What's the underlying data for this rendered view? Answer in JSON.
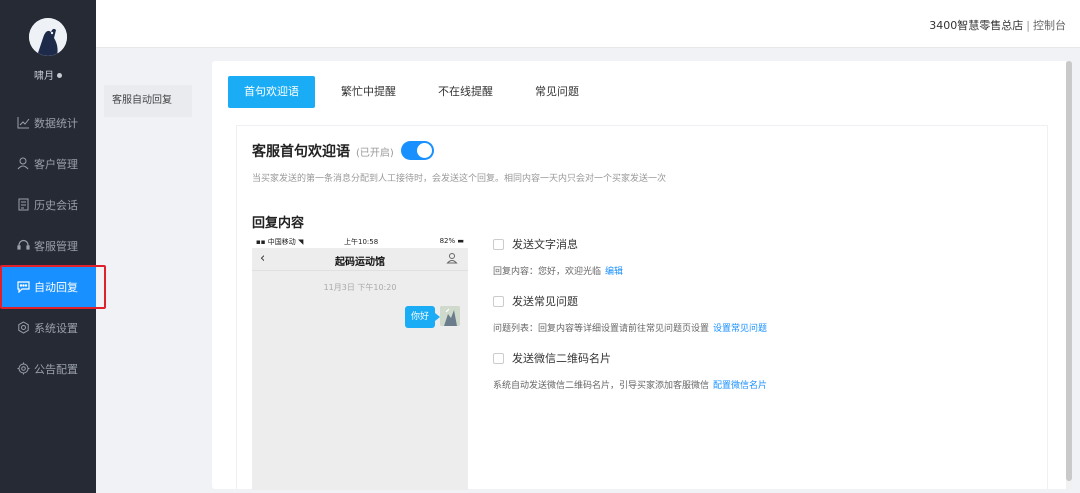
{
  "user": {
    "name": "啸月"
  },
  "nav": {
    "items": [
      {
        "label": "数据统计",
        "icon": "chart-line-icon"
      },
      {
        "label": "客户管理",
        "icon": "user-icon"
      },
      {
        "label": "历史会话",
        "icon": "document-icon"
      },
      {
        "label": "客服管理",
        "icon": "headset-icon"
      },
      {
        "label": "自动回复",
        "icon": "chat-bubble-icon",
        "active": true
      },
      {
        "label": "系统设置",
        "icon": "gear-icon"
      },
      {
        "label": "公告配置",
        "icon": "settings-cog-icon"
      }
    ]
  },
  "header": {
    "store": "3400智慧零售总店",
    "separator": "|",
    "console": "控制台"
  },
  "submenu": {
    "label": "客服自动回复"
  },
  "tabs": [
    {
      "label": "首句欢迎语",
      "active": true
    },
    {
      "label": "繁忙中提醒"
    },
    {
      "label": "不在线提醒"
    },
    {
      "label": "常见问题"
    }
  ],
  "welcome": {
    "title": "客服首句欢迎语",
    "status": "(已开启)",
    "enabled": true,
    "description": "当买家发送的第一条消息分配到人工接待时，会发送这个回复。相同内容一天内只会对一个买家发送一次",
    "reply_title": "回复内容"
  },
  "phone": {
    "carrier": "中国移动",
    "clock": "上午10:58",
    "battery": "82%",
    "chat_name": "起码运动馆",
    "timestamp": "11月3日 下午10:20",
    "message": "你好"
  },
  "options": [
    {
      "label": "发送文字消息",
      "sub_prefix": "回复内容：您好，欢迎光临",
      "link": "编辑",
      "checked": false
    },
    {
      "label": "发送常见问题",
      "sub_prefix": "问题列表：回复内容等详细设置请前往常见问题页设置",
      "link": "设置常见问题",
      "checked": false
    },
    {
      "label": "发送微信二维码名片",
      "sub_prefix": "系统自动发送微信二维码名片，引导买家添加客服微信",
      "link": "配置微信名片",
      "checked": false
    }
  ],
  "colors": {
    "accent": "#1890ff",
    "tab_active": "#1aadf5",
    "sidebar": "#262a35",
    "highlight_border": "#e0212c"
  }
}
